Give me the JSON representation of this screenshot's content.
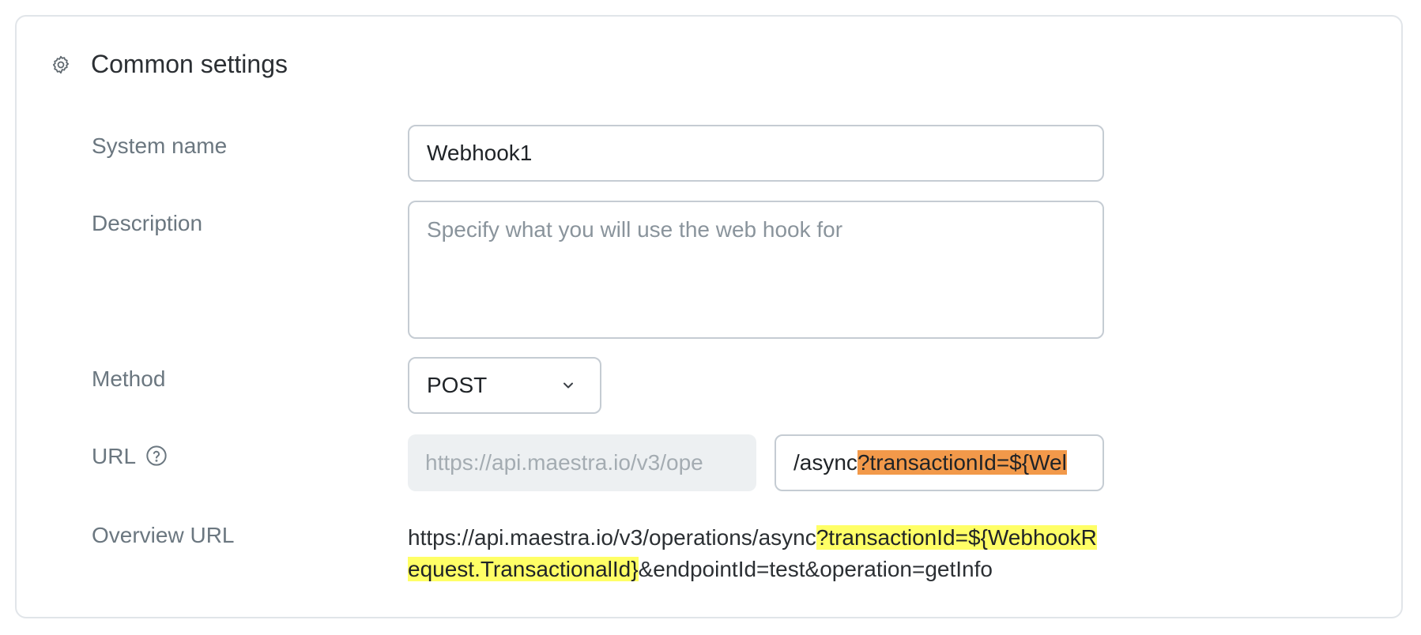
{
  "section": {
    "title": "Common settings",
    "icon": "gear-icon"
  },
  "fields": {
    "system_name": {
      "label": "System name",
      "value": "Webhook1"
    },
    "description": {
      "label": "Description",
      "value": "",
      "placeholder": "Specify what you will use the web hook for"
    },
    "method": {
      "label": "Method",
      "value": "POST",
      "icon": "chevron-down-icon"
    },
    "url": {
      "label": "URL",
      "help_icon": "help-circle-icon",
      "prefix": "https://api.maestra.io/v3/ope",
      "suffix_plain": "/async",
      "suffix_highlight": "?transactionId=${Wel"
    },
    "overview_url": {
      "label": "Overview URL",
      "part1": "https://api.maestra.io/v3/operations/async",
      "highlight": "?transactionId=${WebhookRequest.TransactionalId}",
      "part2": "&endpointId=test&operation=getInfo"
    }
  },
  "colors": {
    "orange_highlight": "#f2994a",
    "yellow_highlight": "#ffff66",
    "border": "#c5ccd3",
    "label": "#6b7780"
  }
}
